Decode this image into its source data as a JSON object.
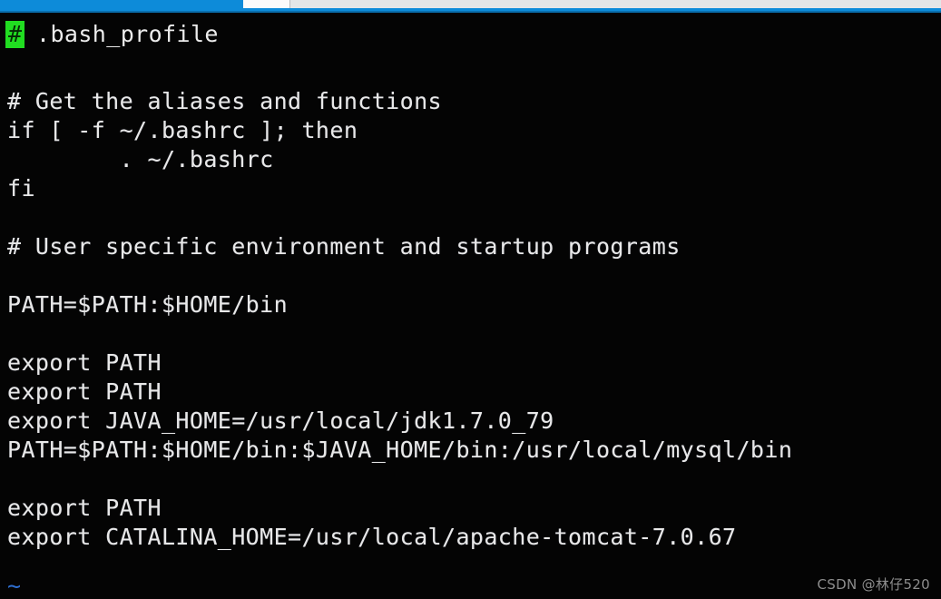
{
  "window": {
    "titlebar_color": "#0d8bd9",
    "strip_color": "#e4e6e7"
  },
  "editor": {
    "cursor_glyph": "#",
    "cursor_color": "#21dd21",
    "filename": ".bash_profile",
    "background_color": "#040404",
    "text_color": "#e8e8e8",
    "empty_line_marker": "~",
    "empty_line_marker_color": "#2f6fd0",
    "lines": [
      {
        "n": 1,
        "text": ""
      },
      {
        "n": 2,
        "text": "# Get the aliases and functions"
      },
      {
        "n": 3,
        "text": "if [ -f ~/.bashrc ]; then"
      },
      {
        "n": 4,
        "text": "        . ~/.bashrc"
      },
      {
        "n": 5,
        "text": "fi"
      },
      {
        "n": 6,
        "text": ""
      },
      {
        "n": 7,
        "text": "# User specific environment and startup programs"
      },
      {
        "n": 8,
        "text": ""
      },
      {
        "n": 9,
        "text": "PATH=$PATH:$HOME/bin"
      },
      {
        "n": 10,
        "text": ""
      },
      {
        "n": 11,
        "text": "export PATH"
      },
      {
        "n": 12,
        "text": "export PATH"
      },
      {
        "n": 13,
        "text": "export JAVA_HOME=/usr/local/jdk1.7.0_79"
      },
      {
        "n": 14,
        "text": "PATH=$PATH:$HOME/bin:$JAVA_HOME/bin:/usr/local/mysql/bin"
      },
      {
        "n": 15,
        "text": ""
      },
      {
        "n": 16,
        "text": "export PATH"
      },
      {
        "n": 17,
        "text": "export CATALINA_HOME=/usr/local/apache-tomcat-7.0.67"
      }
    ]
  },
  "watermark": {
    "text": "CSDN @林仔520"
  }
}
